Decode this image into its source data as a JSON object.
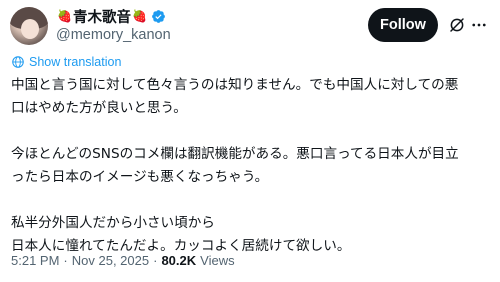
{
  "author": {
    "display_name": "青木歌音",
    "name_decoration": "🍓",
    "handle": "@memory_kanon",
    "verified": true
  },
  "header": {
    "follow_label": "Follow"
  },
  "tweet": {
    "show_translation_label": "Show translation",
    "lines": [
      "中国と言う国に対して色々言うのは知りません。でも中国人に対しての悪",
      "口はやめた方が良いと思う。",
      "",
      "今ほとんどのSNSのコメ欄は翻訳機能がある。悪口言ってる日本人が目立",
      "ったら日本のイメージも悪くなっちゃう。",
      "",
      "私半分外国人だから小さい頃から",
      "日本人に憧れてたんだよ。カッコよく居続けて欲しい。"
    ],
    "time": "5:21 PM",
    "date": "Nov 25, 2025",
    "views_count": "80.2K",
    "views_label": "Views"
  },
  "colors": {
    "accent": "#1d9bf0",
    "text": "#0f1419",
    "muted": "#536471",
    "follow_bg": "#0f1419"
  },
  "icons": [
    "avatar",
    "strawberry-icon",
    "verified-badge-icon",
    "grok-icon",
    "more-options-icon",
    "translate-icon"
  ]
}
